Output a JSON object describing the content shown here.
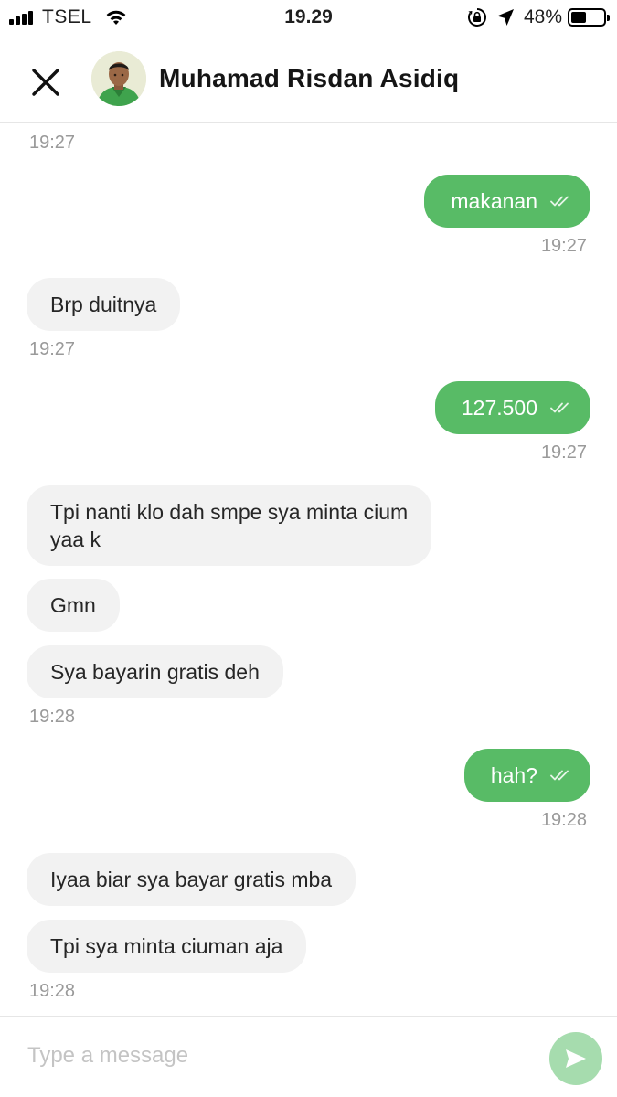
{
  "status_bar": {
    "carrier": "TSEL",
    "time": "19.29",
    "battery_percent": "48%",
    "battery_level": 0.48,
    "icons": [
      "signal-icon",
      "wifi-icon",
      "rotation-lock-icon",
      "location-arrow-icon",
      "battery-icon"
    ]
  },
  "header": {
    "contact_name": "Muhamad Risdan Asidiq",
    "close_icon": "close-icon",
    "avatar": "contact-avatar"
  },
  "messages": [
    {
      "type": "timestamp",
      "side": "left",
      "text": "19:27"
    },
    {
      "type": "message",
      "side": "right",
      "text": "makanan",
      "status": "read-double-check"
    },
    {
      "type": "timestamp",
      "side": "right",
      "text": "19:27"
    },
    {
      "type": "message",
      "side": "left",
      "text": "Brp duitnya"
    },
    {
      "type": "timestamp",
      "side": "left",
      "text": "19:27"
    },
    {
      "type": "message",
      "side": "right",
      "text": "127.500",
      "status": "read-double-check"
    },
    {
      "type": "timestamp",
      "side": "right",
      "text": "19:27"
    },
    {
      "type": "message",
      "side": "left",
      "lines": [
        "Tpi nanti klo dah smpe sya minta cium",
        "yaa k"
      ]
    },
    {
      "type": "message",
      "side": "left",
      "text": "Gmn"
    },
    {
      "type": "message",
      "side": "left",
      "text": "Sya bayarin gratis deh"
    },
    {
      "type": "timestamp",
      "side": "left",
      "text": "19:28"
    },
    {
      "type": "message",
      "side": "right",
      "text": "hah?",
      "status": "read-double-check"
    },
    {
      "type": "timestamp",
      "side": "right",
      "text": "19:28"
    },
    {
      "type": "message",
      "side": "left",
      "text": "Iyaa biar sya bayar gratis mba"
    },
    {
      "type": "message",
      "side": "left",
      "text": "Tpi sya minta ciuman aja"
    },
    {
      "type": "timestamp",
      "side": "left",
      "text": "19:28"
    }
  ],
  "composer": {
    "placeholder": "Type a message",
    "value": "",
    "send_icon": "send-icon"
  },
  "colors": {
    "outgoing_bubble": "#58bb66",
    "incoming_bubble": "#f2f2f2",
    "send_button": "#a6dcae",
    "timestamp": "#9a9a9a"
  }
}
